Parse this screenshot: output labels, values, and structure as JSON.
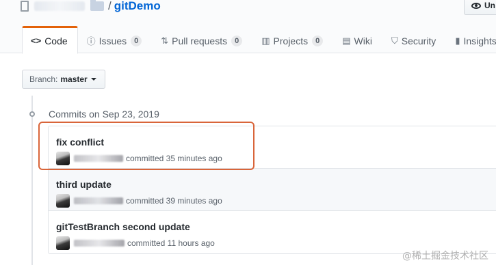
{
  "repo": {
    "name": "gitDemo",
    "separator": "/"
  },
  "header": {
    "unwatch_label": "Un"
  },
  "tabs": [
    {
      "icon": "code-icon",
      "glyph": "<>",
      "label": "Code",
      "selected": true
    },
    {
      "icon": "issue-icon",
      "glyph": "ⓘ",
      "label": "Issues",
      "count": "0"
    },
    {
      "icon": "pull-request-icon",
      "glyph": "⇅",
      "label": "Pull requests",
      "count": "0"
    },
    {
      "icon": "project-icon",
      "glyph": "▥",
      "label": "Projects",
      "count": "0"
    },
    {
      "icon": "wiki-icon",
      "glyph": "▤",
      "label": "Wiki"
    },
    {
      "icon": "shield-icon",
      "glyph": "⛉",
      "label": "Security"
    },
    {
      "icon": "graph-icon",
      "glyph": "▮",
      "label": "Insights"
    }
  ],
  "branch": {
    "label": "Branch:",
    "value": "master"
  },
  "commit_group": {
    "title": "Commits on Sep 23, 2019"
  },
  "commits": [
    {
      "message": "fix conflict",
      "time": "committed 35 minutes ago"
    },
    {
      "message": "third update",
      "time": "committed 39 minutes ago"
    },
    {
      "message": "gitTestBranch second update",
      "time": "committed 11 hours ago"
    }
  ],
  "watermark": "@稀土掘金技术社区",
  "colors": {
    "link": "#0366d6",
    "tab_accent": "#e36209",
    "highlight_box": "#d9653a"
  }
}
